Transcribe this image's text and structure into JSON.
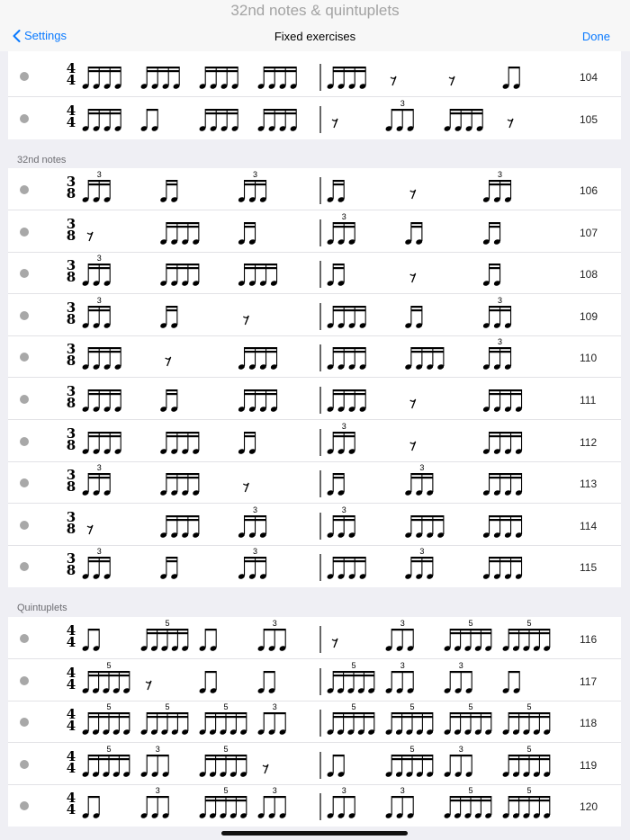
{
  "app": {
    "title": "32nd notes & quintuplets"
  },
  "nav": {
    "back_label": "Settings",
    "title": "Fixed exercises",
    "done_label": "Done"
  },
  "sections": [
    {
      "header": "",
      "rows": [
        {
          "number": "104",
          "time": [
            "4",
            "4"
          ],
          "kind": "44a"
        },
        {
          "number": "105",
          "time": [
            "4",
            "4"
          ],
          "kind": "44b"
        }
      ]
    },
    {
      "header": "32nd notes",
      "rows": [
        {
          "number": "106",
          "time": [
            "3",
            "8"
          ],
          "kind": "38"
        },
        {
          "number": "107",
          "time": [
            "3",
            "8"
          ],
          "kind": "38"
        },
        {
          "number": "108",
          "time": [
            "3",
            "8"
          ],
          "kind": "38"
        },
        {
          "number": "109",
          "time": [
            "3",
            "8"
          ],
          "kind": "38"
        },
        {
          "number": "110",
          "time": [
            "3",
            "8"
          ],
          "kind": "38"
        },
        {
          "number": "111",
          "time": [
            "3",
            "8"
          ],
          "kind": "38"
        },
        {
          "number": "112",
          "time": [
            "3",
            "8"
          ],
          "kind": "38"
        },
        {
          "number": "113",
          "time": [
            "3",
            "8"
          ],
          "kind": "38"
        },
        {
          "number": "114",
          "time": [
            "3",
            "8"
          ],
          "kind": "38"
        },
        {
          "number": "115",
          "time": [
            "3",
            "8"
          ],
          "kind": "38"
        }
      ]
    },
    {
      "header": "Quintuplets",
      "rows": [
        {
          "number": "116",
          "time": [
            "4",
            "4"
          ],
          "kind": "q"
        },
        {
          "number": "117",
          "time": [
            "4",
            "4"
          ],
          "kind": "q"
        },
        {
          "number": "118",
          "time": [
            "4",
            "4"
          ],
          "kind": "q"
        },
        {
          "number": "119",
          "time": [
            "4",
            "4"
          ],
          "kind": "q"
        },
        {
          "number": "120",
          "time": [
            "4",
            "4"
          ],
          "kind": "q"
        }
      ]
    }
  ],
  "tuplet_labels": {
    "triplet": "3",
    "quintuplet": "5"
  },
  "colors": {
    "accent": "#0a7aff",
    "bullet": "#a8a8a8",
    "header_text": "#6d6d72",
    "background": "#efeff4"
  },
  "icons": {
    "back": "chevron-left-icon",
    "bullet": "status-dot-icon"
  }
}
